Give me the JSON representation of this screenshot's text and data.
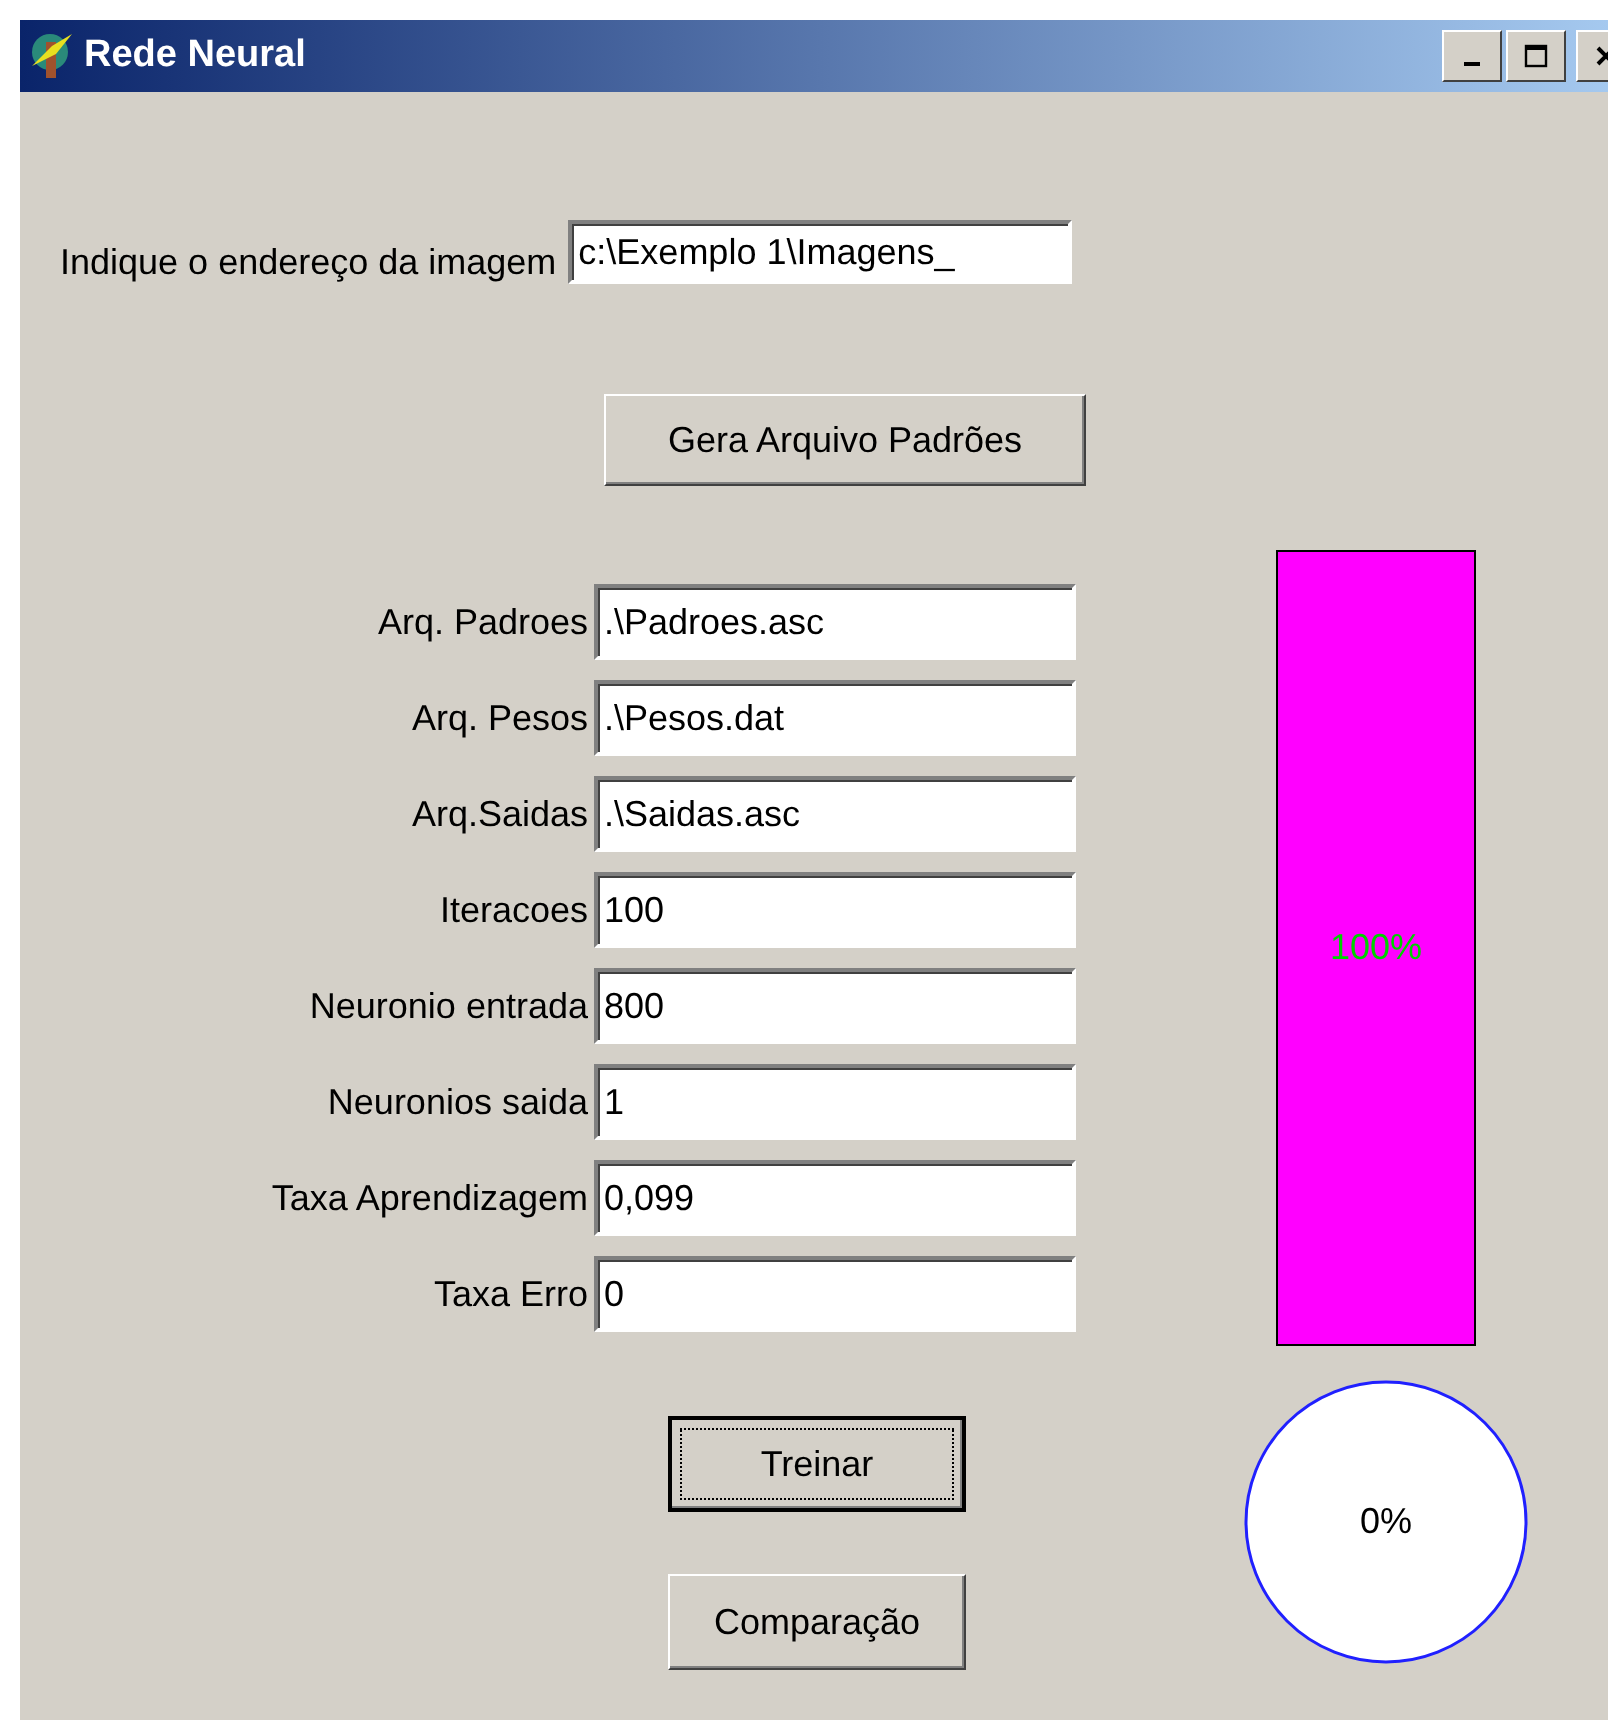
{
  "window": {
    "title": "Rede Neural"
  },
  "image_path": {
    "label": "Indique o endereço da imagem",
    "value": "c:\\Exemplo 1\\Imagens_"
  },
  "generate_button": "Gera Arquivo Padrões",
  "fields": [
    {
      "label": "Arq. Padroes",
      "value": ".\\Padroes.asc"
    },
    {
      "label": "Arq. Pesos",
      "value": ".\\Pesos.dat"
    },
    {
      "label": "Arq.Saidas",
      "value": ".\\Saidas.asc"
    },
    {
      "label": "Iteracoes",
      "value": "100"
    },
    {
      "label": "Neuronio entrada",
      "value": "800"
    },
    {
      "label": "Neuronios saida",
      "value": "1"
    },
    {
      "label": "Taxa Aprendizagem",
      "value": "0,099"
    },
    {
      "label": "Taxa Erro",
      "value": "0"
    }
  ],
  "buttons": [
    {
      "label": "Treinar",
      "focused": true
    },
    {
      "label": "Comparação",
      "focused": false
    }
  ],
  "progress_bar": {
    "level": 1,
    "reading": "100%"
  },
  "circle_gauge": {
    "level": 0,
    "reading": "0%"
  }
}
